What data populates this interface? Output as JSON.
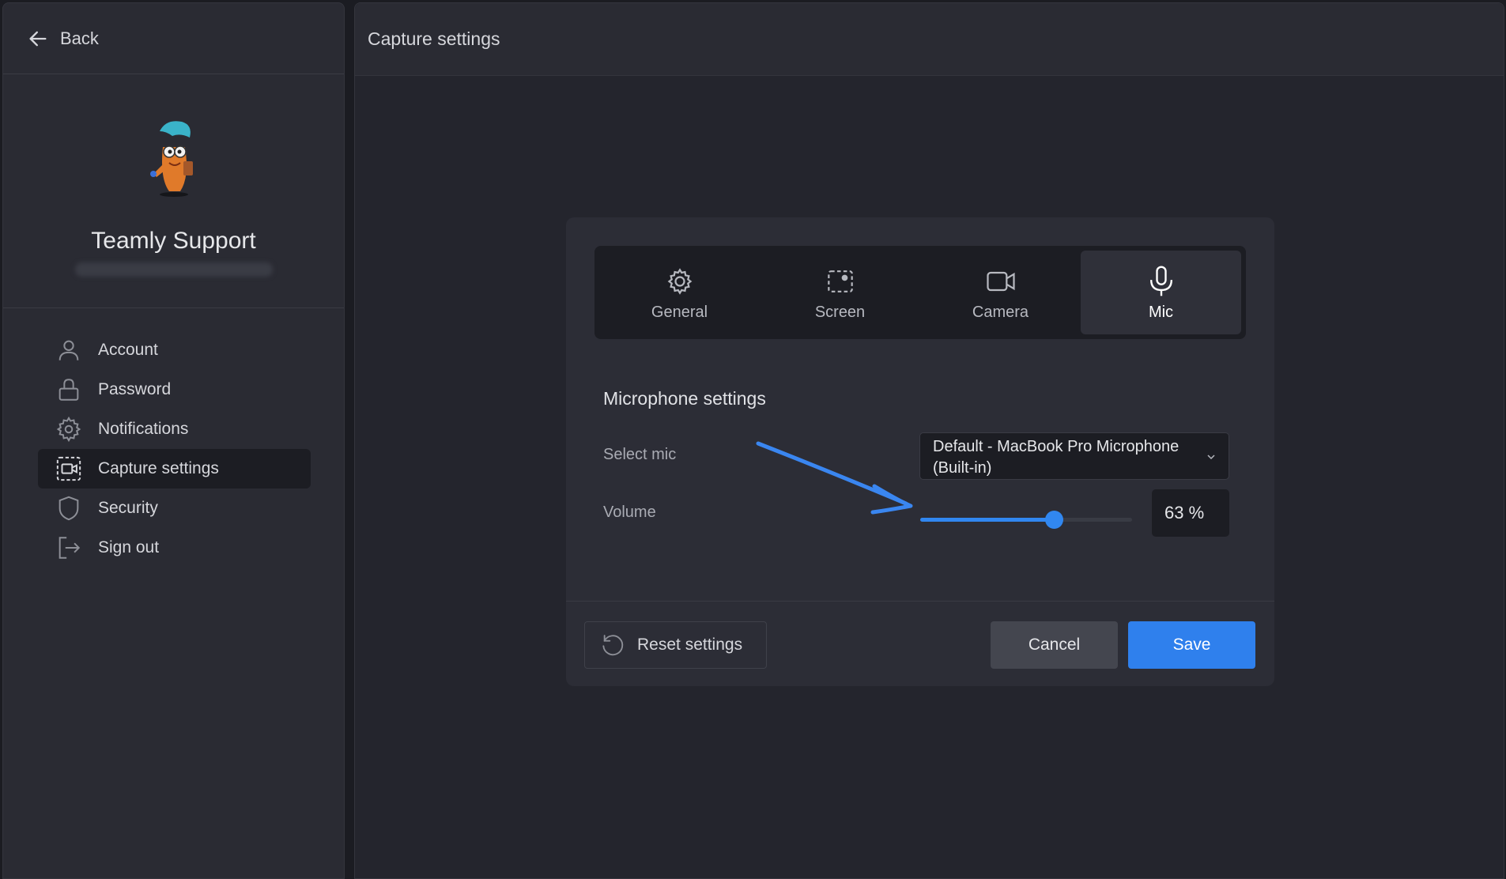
{
  "sidebar": {
    "back_label": "Back",
    "profile": {
      "name": "Teamly Support"
    },
    "items": [
      {
        "label": "Account",
        "icon": "user-icon"
      },
      {
        "label": "Password",
        "icon": "lock-icon"
      },
      {
        "label": "Notifications",
        "icon": "gear-icon"
      },
      {
        "label": "Capture settings",
        "icon": "capture-icon",
        "active": true
      },
      {
        "label": "Security",
        "icon": "shield-icon"
      },
      {
        "label": "Sign out",
        "icon": "sign-out-icon"
      }
    ]
  },
  "header": {
    "title": "Capture settings"
  },
  "dialog": {
    "tabs": [
      {
        "label": "General",
        "icon": "gear-icon"
      },
      {
        "label": "Screen",
        "icon": "screen-select-icon"
      },
      {
        "label": "Camera",
        "icon": "camera-icon"
      },
      {
        "label": "Mic",
        "icon": "microphone-icon",
        "active": true
      }
    ],
    "section_title": "Microphone settings",
    "select_mic_label": "Select mic",
    "select_mic_value": "Default - MacBook Pro Microphone (Built-in)",
    "volume_label": "Volume",
    "volume_value": "63 %",
    "volume_fraction": 0.63,
    "reset_label": "Reset settings",
    "cancel_label": "Cancel",
    "save_label": "Save"
  },
  "colors": {
    "accent": "#2f80ed",
    "annotation_arrow": "#3a86f0"
  }
}
